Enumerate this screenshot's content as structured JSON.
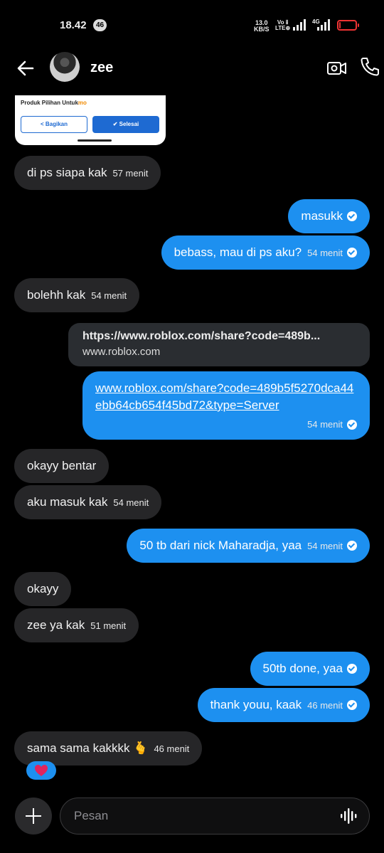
{
  "status_bar": {
    "time": "18.42",
    "notification_count": "46",
    "speed_value": "13.0",
    "speed_unit": "KB/S",
    "volte_top": "Vo ⅱ",
    "volte_bottom": "LTE⊕",
    "network": "4G",
    "battery_level": 0.08,
    "battery_color": "#e33333"
  },
  "header": {
    "contact_name": "zee",
    "icons": [
      "back-arrow-icon",
      "video-call-icon",
      "phone-call-icon"
    ]
  },
  "shared_preview": {
    "title": "Produk Pilihan Untuk",
    "title_brand": "mo",
    "share_label": "Bagikan",
    "done_label": "Selesai"
  },
  "messages": [
    {
      "dir": "in",
      "text": "di ps siapa kak",
      "time": "57 menit"
    },
    {
      "dir": "out",
      "text": "masukk",
      "time": ""
    },
    {
      "dir": "out",
      "text": "bebass, mau di ps aku?",
      "time": "54 menit"
    },
    {
      "dir": "in",
      "text": "bolehh kak",
      "time": "54 menit"
    },
    {
      "dir": "in",
      "text": "okayy bentar",
      "time": ""
    },
    {
      "dir": "in",
      "text": "aku masuk kak",
      "time": "54 menit"
    },
    {
      "dir": "out",
      "text": "50 tb dari nick Maharadja, yaa",
      "time": "54 menit"
    },
    {
      "dir": "in",
      "text": "okayy",
      "time": ""
    },
    {
      "dir": "in",
      "text": "zee ya kak",
      "time": "51 menit"
    },
    {
      "dir": "out",
      "text": "50tb done, yaa",
      "time": ""
    },
    {
      "dir": "out",
      "text": "thank youu, kaak",
      "time": "46 menit"
    },
    {
      "dir": "in",
      "text": "sama sama kakkkk 🫰",
      "time": "46 menit"
    }
  ],
  "link_preview": {
    "url": "https://www.roblox.com/share?code=489b...",
    "domain": "www.roblox.com"
  },
  "link_message": {
    "text": "www.roblox.com/share?code=489b5f5270dca44ebb64cb654f45bd72&type=Server",
    "time": "54 menit"
  },
  "reaction": {
    "icon": "heart-icon",
    "color": "#e0245e"
  },
  "composer": {
    "placeholder": "Pesan",
    "icons": [
      "plus-icon",
      "voice-wave-icon"
    ]
  },
  "colors": {
    "incoming_bubble": "#262628",
    "outgoing_bubble": "#1d90f0",
    "background": "#000000"
  }
}
